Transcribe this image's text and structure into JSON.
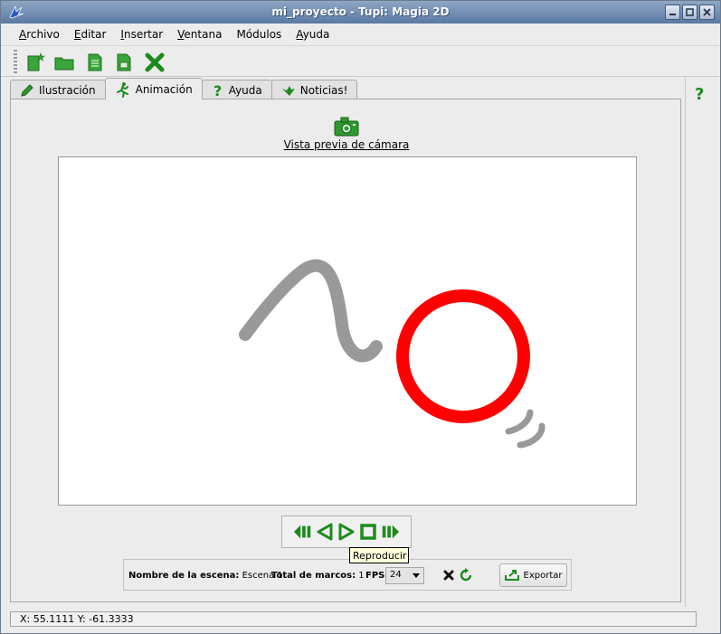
{
  "window": {
    "title": "mi_proyecto - Tupi: Magia 2D"
  },
  "menu": [
    {
      "mnemonic": "A",
      "rest": "rchivo"
    },
    {
      "mnemonic": "E",
      "rest": "ditar"
    },
    {
      "mnemonic": "I",
      "rest": "nsertar"
    },
    {
      "mnemonic": "V",
      "rest": "entana"
    },
    {
      "mnemonic": "",
      "rest": "Módulos"
    },
    {
      "mnemonic": "A",
      "rest": "yuda"
    }
  ],
  "toolbar": {
    "icons": [
      "new-project-icon",
      "open-project-icon",
      "save-project-icon",
      "save-as-icon",
      "close-project-icon"
    ]
  },
  "tabs": [
    {
      "label": "Ilustración",
      "icon": "pencil-icon"
    },
    {
      "label": "Animación",
      "icon": "running-man-icon"
    },
    {
      "label": "Ayuda",
      "icon": "question-icon"
    },
    {
      "label": "Noticias!",
      "icon": "bird-icon"
    }
  ],
  "active_tab": "Animación",
  "camera": {
    "label": "Vista previa de cámara"
  },
  "player": {
    "buttons": [
      "rewind",
      "play-backward",
      "play",
      "stop",
      "fast-forward"
    ],
    "tooltip": "Reproducir"
  },
  "scene_status": {
    "scene_name_label": "Nombre de la escena:",
    "scene_name": "Escena 1",
    "total_frames_label": "Total de marcos:",
    "total_frames": "1",
    "fps_label": "FPS:",
    "fps_value": "24",
    "export_label": "Exportar"
  },
  "statusbar": {
    "coords": "X: 55.1111 Y: -61.3333"
  },
  "colors": {
    "accent_green": "#1e8a1e",
    "circle_red": "#ff0000",
    "stroke_gray": "#999999"
  }
}
